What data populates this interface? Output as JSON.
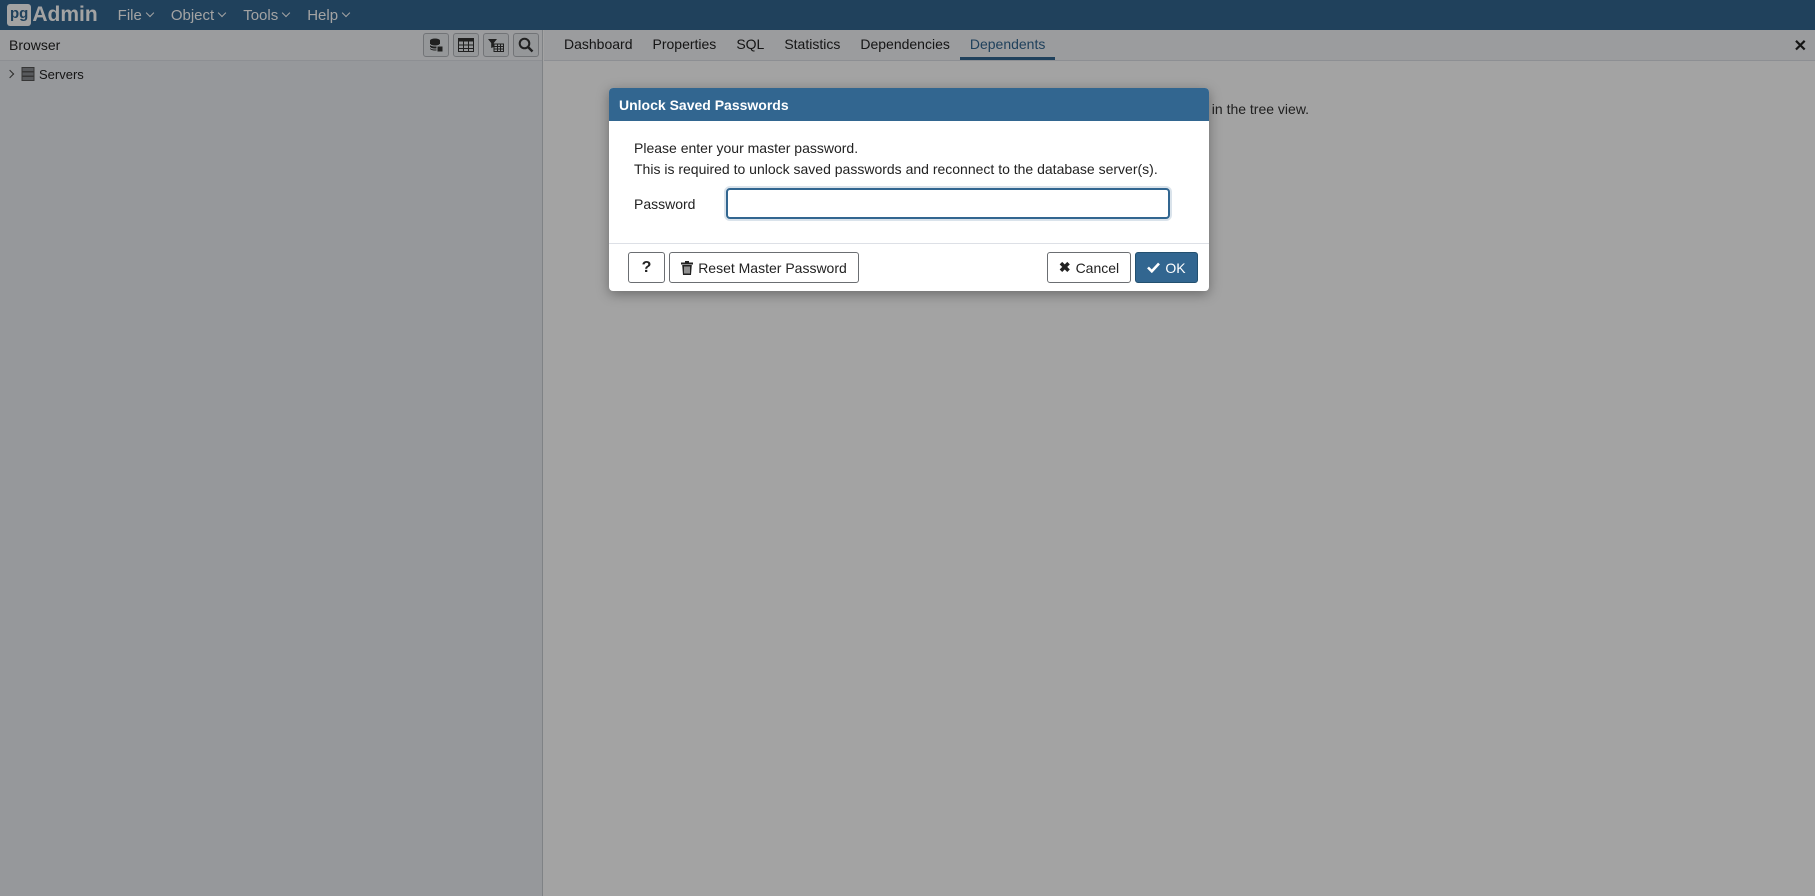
{
  "app": {
    "brand_prefix": "pg",
    "brand_suffix": "Admin",
    "menus": [
      {
        "label": "File"
      },
      {
        "label": "Object"
      },
      {
        "label": "Tools"
      },
      {
        "label": "Help"
      }
    ]
  },
  "browser": {
    "title": "Browser",
    "tools": [
      "database-icon",
      "table-icon",
      "filtered-rows-icon",
      "search-icon"
    ],
    "tree": [
      {
        "label": "Servers",
        "icon": "servers-icon",
        "expanded": false
      }
    ]
  },
  "main": {
    "tabs": [
      {
        "label": "Dashboard"
      },
      {
        "label": "Properties"
      },
      {
        "label": "SQL"
      },
      {
        "label": "Statistics"
      },
      {
        "label": "Dependencies"
      },
      {
        "label": "Dependents",
        "active": true
      }
    ],
    "message_visible_tail": "t in the tree view."
  },
  "dialog": {
    "title": "Unlock Saved Passwords",
    "line1": "Please enter your master password.",
    "line2": "This is required to unlock saved passwords and reconnect to the database server(s).",
    "password_label": "Password",
    "password_value": "",
    "help_label": "?",
    "reset_label": "Reset Master Password",
    "cancel_label": "Cancel",
    "ok_label": "OK"
  },
  "colors": {
    "primary": "#326690",
    "panel_bg": "#ebeef3"
  }
}
